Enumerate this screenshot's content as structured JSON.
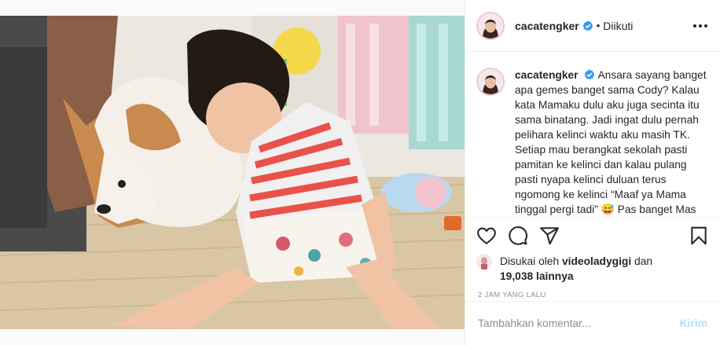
{
  "post": {
    "username": "cacatengker",
    "follow_status": "Diikuti",
    "separator": "•"
  },
  "caption": {
    "username": "cacatengker",
    "text": "Ansara sayang banget apa gemes banget sama Cody? Kalau kata Mamaku dulu aku juga secinta itu sama binatang. Jadi ingat dulu pernah pelihara kelinci waktu aku masih TK. Setiap mau berangkat sekolah pasti pamitan ke kelinci dan kalau pulang pasti nyapa kelinci duluan terus ngomong ke kelinci “Maaf ya Mama tinggal pergi tadi” 😅 Pas banget Mas"
  },
  "likes": {
    "prefix": "Disukai oleh",
    "liker": "videoladygigi",
    "conjunction": "dan",
    "count": "19,038 lainnya"
  },
  "timestamp": "2 JAM YANG LALU",
  "comment_box": {
    "placeholder": "Tambahkan komentar...",
    "post_label": "Kirim"
  },
  "icons": {
    "like": "heart-icon",
    "comment": "comment-icon",
    "share": "share-icon",
    "save": "bookmark-icon",
    "options": "more-icon",
    "verified": "verified-badge-icon"
  },
  "colors": {
    "verified": "#3897f0",
    "post_button_disabled": "#b2dffc",
    "muted_text": "#8e8e8e"
  }
}
